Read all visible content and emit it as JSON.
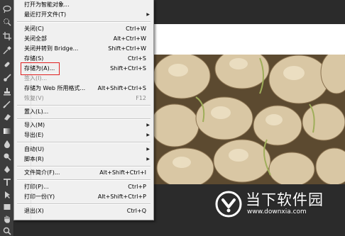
{
  "menu": {
    "items": [
      {
        "label": "打开为智能对象...",
        "shortcut": "",
        "disabled": false,
        "submenu": false
      },
      {
        "label": "最近打开文件(T)",
        "shortcut": "",
        "disabled": false,
        "submenu": true
      },
      {
        "label": "关闭(C)",
        "shortcut": "Ctrl+W",
        "disabled": false,
        "submenu": false
      },
      {
        "label": "关闭全部",
        "shortcut": "Alt+Ctrl+W",
        "disabled": false,
        "submenu": false
      },
      {
        "label": "关闭并转到 Bridge...",
        "shortcut": "Shift+Ctrl+W",
        "disabled": false,
        "submenu": false
      },
      {
        "label": "存储(S)",
        "shortcut": "Ctrl+S",
        "disabled": false,
        "submenu": false
      },
      {
        "label": "存储为(A)...",
        "shortcut": "Shift+Ctrl+S",
        "disabled": false,
        "submenu": false
      },
      {
        "label": "签入(I)...",
        "shortcut": "",
        "disabled": true,
        "submenu": false
      },
      {
        "label": "存储为 Web 所用格式...",
        "shortcut": "Alt+Shift+Ctrl+S",
        "disabled": false,
        "submenu": false
      },
      {
        "label": "恢复(V)",
        "shortcut": "F12",
        "disabled": true,
        "submenu": false
      },
      {
        "label": "置入(L)...",
        "shortcut": "",
        "disabled": false,
        "submenu": false
      },
      {
        "label": "导入(M)",
        "shortcut": "",
        "disabled": false,
        "submenu": true
      },
      {
        "label": "导出(E)",
        "shortcut": "",
        "disabled": false,
        "submenu": true
      },
      {
        "label": "自动(U)",
        "shortcut": "",
        "disabled": false,
        "submenu": true
      },
      {
        "label": "脚本(R)",
        "shortcut": "",
        "disabled": false,
        "submenu": true
      },
      {
        "label": "文件简介(F)...",
        "shortcut": "Alt+Shift+Ctrl+I",
        "disabled": false,
        "submenu": false
      },
      {
        "label": "打印(P)...",
        "shortcut": "Ctrl+P",
        "disabled": false,
        "submenu": false
      },
      {
        "label": "打印一份(Y)",
        "shortcut": "Alt+Shift+Ctrl+P",
        "disabled": false,
        "submenu": false
      },
      {
        "label": "退出(X)",
        "shortcut": "Ctrl+Q",
        "disabled": false,
        "submenu": false
      }
    ]
  },
  "watermark": {
    "title": "当下软件园",
    "url": "www.downxia.com"
  },
  "tools": [
    "lasso-icon",
    "quick-select-icon",
    "crop-icon",
    "eyedropper-icon",
    "healing-brush-icon",
    "brush-icon",
    "clone-stamp-icon",
    "history-brush-icon",
    "eraser-icon",
    "gradient-icon",
    "blur-icon",
    "dodge-icon",
    "pen-icon",
    "type-icon",
    "path-select-icon",
    "shape-icon",
    "hand-icon",
    "zoom-icon"
  ],
  "colors": {
    "toolbar": "#3c3c3c",
    "menu_bg": "#f0f0f0",
    "highlight": "#e02020",
    "workspace": "#2b2b2b"
  }
}
